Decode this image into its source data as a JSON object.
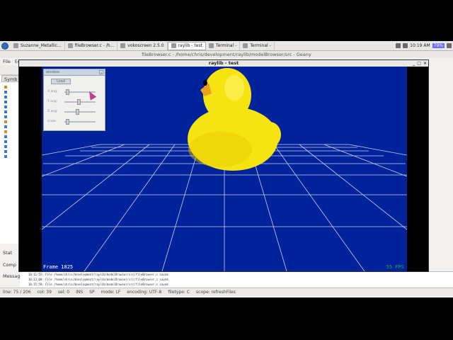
{
  "taskbar": {
    "tasks": [
      {
        "label": "Suzanne_Metallic..."
      },
      {
        "label": "fileBrowser.c - /h..."
      },
      {
        "label": "vokoscreen 2.5.0"
      },
      {
        "label": "raylib - test"
      },
      {
        "label": "Terminal -"
      },
      {
        "label": "Terminal -"
      }
    ],
    "clock": "10:19 AM",
    "battery": "79%"
  },
  "geany": {
    "title": "fileBrowser.c - /home/chris/development/raylib/modelBrowser/src - Geany",
    "menu": [
      "File",
      "Ed"
    ],
    "side_tab": "Symb",
    "bottom_tabs": [
      "Stat",
      "Comp",
      "Messages"
    ],
    "messages": [
      "10:11:55: File /home/chris/development/raylib/modelBrowser/src/fileBrowser.c saved.",
      "10:13:00: File /home/chris/development/raylib/modelBrowser/src/fileBrowser.c saved.",
      "10:15:59: File /home/chris/development/raylib/modelBrowser/src/fileBrowser.c saved."
    ],
    "status": {
      "line": "line: 75 / 206",
      "col": "col: 39",
      "sel": "sel: 0",
      "ins": "INS",
      "sp": "SP",
      "mode": "mode: LF",
      "encoding": "encoding: UTF-8",
      "filetype": "filetype: C",
      "scope": "scope: refreshFiles"
    }
  },
  "raylib": {
    "window_title": "raylib - test",
    "controls": [
      "_",
      "□",
      "×"
    ],
    "frame_counter": "Frame 1825",
    "fps": "55 FPS",
    "gui": {
      "title": "window",
      "close": "x",
      "load_button": "Load",
      "sliders": [
        {
          "label": "X ang:",
          "value": 0.05
        },
        {
          "label": "Y ang:",
          "value": 0.45
        },
        {
          "label": "Z ang:",
          "value": 0.42
        },
        {
          "label": "scale:",
          "value": 0.05
        }
      ]
    }
  },
  "colors": {
    "viewport_bg": "#00239c",
    "grid": "#c8d1ee",
    "duck": "#f6e411",
    "beak": "#e8a21c",
    "fps_text": "#1fa53b"
  }
}
